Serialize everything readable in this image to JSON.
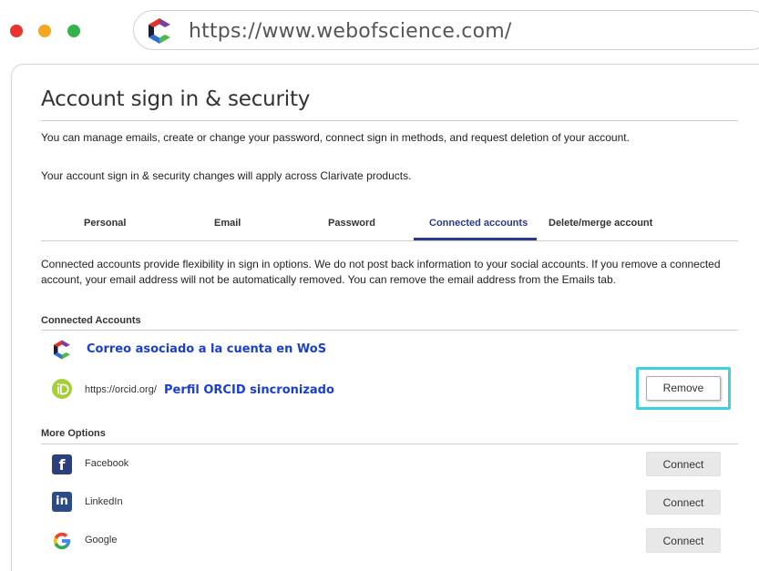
{
  "browser": {
    "url": "https://www.webofscience.com/"
  },
  "page": {
    "title": "Account sign in & security",
    "description_1": "You can manage emails, create or change your password, connect sign in methods, and request deletion of your account.",
    "description_2": "Your account sign in & security changes will apply across Clarivate products."
  },
  "tabs": [
    {
      "label": "Personal",
      "active": false
    },
    {
      "label": "Email",
      "active": false
    },
    {
      "label": "Password",
      "active": false
    },
    {
      "label": "Connected accounts",
      "active": true
    },
    {
      "label": "Delete/merge account",
      "active": false
    }
  ],
  "connected": {
    "intro": "Connected accounts provide flexibility in sign in options. We do not post back information to your social accounts. If you remove a connected account, your email address will not be automatically removed. You can remove the email address from the Emails tab.",
    "heading": "Connected Accounts",
    "wos_label": "Correo asociado a la cuenta en WoS",
    "orcid_url": "https://orcid.org/",
    "orcid_label": "Perfil ORCID sincronizado",
    "remove_label": "Remove"
  },
  "more_options": {
    "heading": "More Options",
    "items": [
      {
        "label": "Facebook",
        "button": "Connect",
        "icon": "facebook-icon"
      },
      {
        "label": "LinkedIn",
        "button": "Connect",
        "icon": "linkedin-icon"
      },
      {
        "label": "Google",
        "button": "Connect",
        "icon": "google-icon"
      }
    ]
  },
  "colors": {
    "accent": "#2c3a8c",
    "link_blue": "#1a3fcf",
    "highlight": "#3cd0e2",
    "orcid_green": "#a6ce39"
  }
}
